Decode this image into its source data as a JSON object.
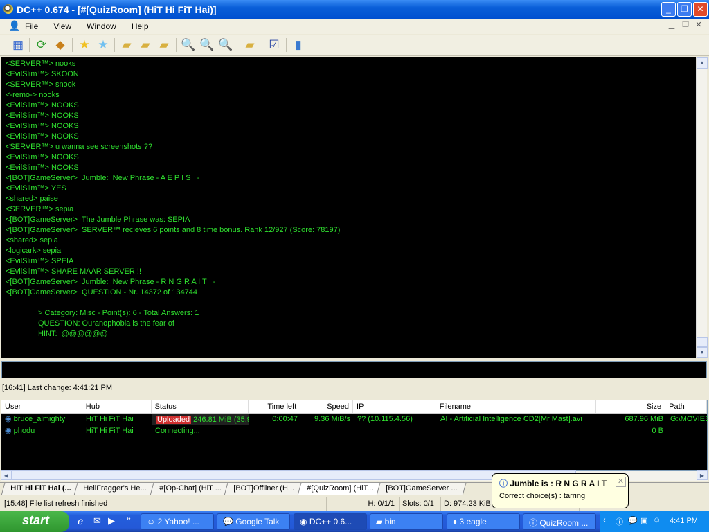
{
  "window": {
    "title": "DC++ 0.674 - [#[QuizRoom] (HiT Hi FiT Hai)]",
    "minimize": "_",
    "maximize": "❐",
    "close": "✕"
  },
  "menu": [
    "File",
    "View",
    "Window",
    "Help"
  ],
  "toolbar_icons": [
    "public-hubs-icon",
    "reconnect-icon",
    "follow-redirect-icon",
    "favorite-hubs-icon",
    "favorite-users-icon",
    "download-queue-icon",
    "finished-downloads-icon",
    "finished-uploads-icon",
    "search-icon",
    "adl-search-icon",
    "search-spy-icon",
    "open-file-list-icon",
    "settings-icon",
    "notepad-icon"
  ],
  "chat": {
    "lines": [
      "<SERVER™> nooks",
      "<EvilSlim™> SKOON",
      "<SERVER™> snook",
      "<-remo-> nooks",
      "<EvilSlim™> NOOKS",
      "<EvilSlim™> NOOKS",
      "<EvilSlim™> NOOKS",
      "<EvilSlim™> NOOKS",
      "<SERVER™> u wanna see screenshots ??",
      "<EvilSlim™> NOOKS",
      "<EvilSlim™> NOOKS",
      "<[BOT]GameServer>  Jumble:  New Phrase - A E P I S   -",
      "<EvilSlim™> YES",
      "<shared> paise",
      "<SERVER™> sepia",
      "<[BOT]GameServer>  The Jumble Phrase was: SEPIA",
      "<[BOT]GameServer>  SERVER™ recieves 6 points and 8 time bonus. Rank 12/927 (Score: 78197)",
      "<shared> sepia",
      "<logicark> sepia",
      "<EvilSlim™> SPEIA",
      "<EvilSlim™> SHARE MAAR SERVER !!",
      "<[BOT]GameServer>  Jumble:  New Phrase - R N G R A I T   -",
      "<[BOT]GameServer>  QUESTION - Nr. 14372 of 134744"
    ],
    "indented": [
      "> Category: Misc - Point(s): 6 - Total Answers: 1",
      "QUESTION: Ouranophobia is the fear of",
      "HINT:  @@@@@@"
    ],
    "text_color": "#2fe02f"
  },
  "status_line": "[16:41] Last change: 4:41:21 PM",
  "transfers": {
    "columns": [
      "User",
      "Hub",
      "Status",
      "Time left",
      "Speed",
      "IP",
      "Filename",
      "Size",
      "Path"
    ],
    "rows": [
      {
        "user": "bruce_almighty",
        "hub": "HiT Hi FiT Hai",
        "status_badge": "Uploaded",
        "status": "246.81 MiB (35.9%",
        "progress": 35.9,
        "time_left": "0:00:47",
        "speed": "9.36 MiB/s",
        "ip": "?? (10.115.4.56)",
        "filename": "AI - Artificial Intelligence CD2[Mr Mast].avi",
        "size": "687.96 MiB",
        "path": "G:\\MOVIES"
      },
      {
        "user": "phodu",
        "hub": "HiT Hi FiT Hai",
        "status_badge": "",
        "status": "Connecting...",
        "time_left": "",
        "speed": "",
        "ip": "",
        "filename": "",
        "size": "0 B",
        "path": ""
      }
    ]
  },
  "tabs": [
    "HiT Hi FiT Hai (...",
    "HellFragger's He...",
    "#[Op-Chat] (HiT ...",
    "[BOT]Offliner (H...",
    "#[QuizRoom] (HiT...",
    "[BOT]GameServer ..."
  ],
  "statusbar": {
    "message": "[15:48] File list refresh finished",
    "hubs": "H: 0/1/1",
    "slots": "Slots: 0/1",
    "download": "D: 974.23 KiB",
    "upload": "U: 18.",
    "rate": "4 MiB/s (1)"
  },
  "balloon": {
    "title": "Jumble is : R N G R A I T",
    "body": "Correct choice(s) : tarring"
  },
  "taskbar": {
    "start": "start",
    "items": [
      "2 Yahoo! ...",
      "Google Talk",
      "DC++ 0.6...",
      "bin",
      "3 eagle",
      "QuizRoom ..."
    ],
    "clock": "4:41 PM"
  }
}
